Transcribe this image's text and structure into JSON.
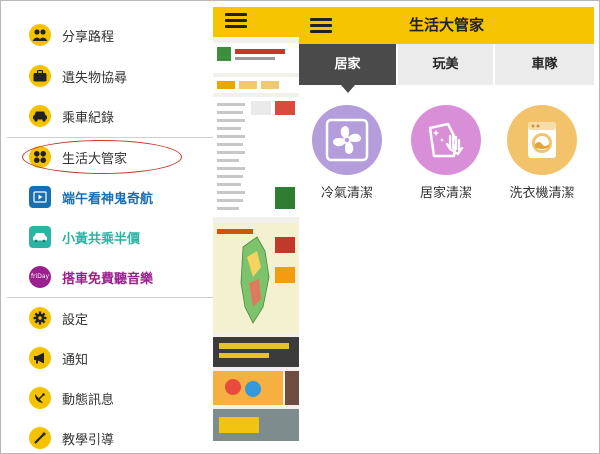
{
  "drawer": {
    "items": [
      {
        "label": "分享路程",
        "icon": "people-icon"
      },
      {
        "label": "遺失物協尋",
        "icon": "briefcase-icon"
      },
      {
        "label": "乘車紀錄",
        "icon": "car-icon"
      },
      {
        "label": "生活大管家",
        "icon": "grid-icon"
      },
      {
        "label": "端午看神鬼奇航",
        "icon": "film-icon",
        "color": "#1a6fb0"
      },
      {
        "label": "小黃共乘半價",
        "icon": "taxi-icon",
        "color": "#2bb3a3"
      },
      {
        "label": "搭車免費聽音樂",
        "icon": "friday-music-icon",
        "icon_text": "friDay",
        "color": "#9b1f8f"
      },
      {
        "label": "設定",
        "icon": "gear-icon"
      },
      {
        "label": "通知",
        "icon": "megaphone-icon"
      },
      {
        "label": "動態訊息",
        "icon": "satellite-icon"
      },
      {
        "label": "教學引導",
        "icon": "wand-icon"
      }
    ]
  },
  "app": {
    "title": "生活大管家",
    "tabs": [
      {
        "label": "居家",
        "active": true
      },
      {
        "label": "玩美",
        "active": false
      },
      {
        "label": "車隊",
        "active": false
      }
    ],
    "services": [
      {
        "label": "冷氣清潔",
        "color": "#b39ddb",
        "icon": "fan-icon"
      },
      {
        "label": "居家清潔",
        "color": "#d98fd8",
        "icon": "hand-cleaning-icon"
      },
      {
        "label": "洗衣機清潔",
        "color": "#f2c36b",
        "icon": "washing-machine-icon"
      }
    ]
  },
  "colors": {
    "accent": "#f6c400",
    "tab_active": "#4a4a4a",
    "highlight": "#c0392b"
  }
}
